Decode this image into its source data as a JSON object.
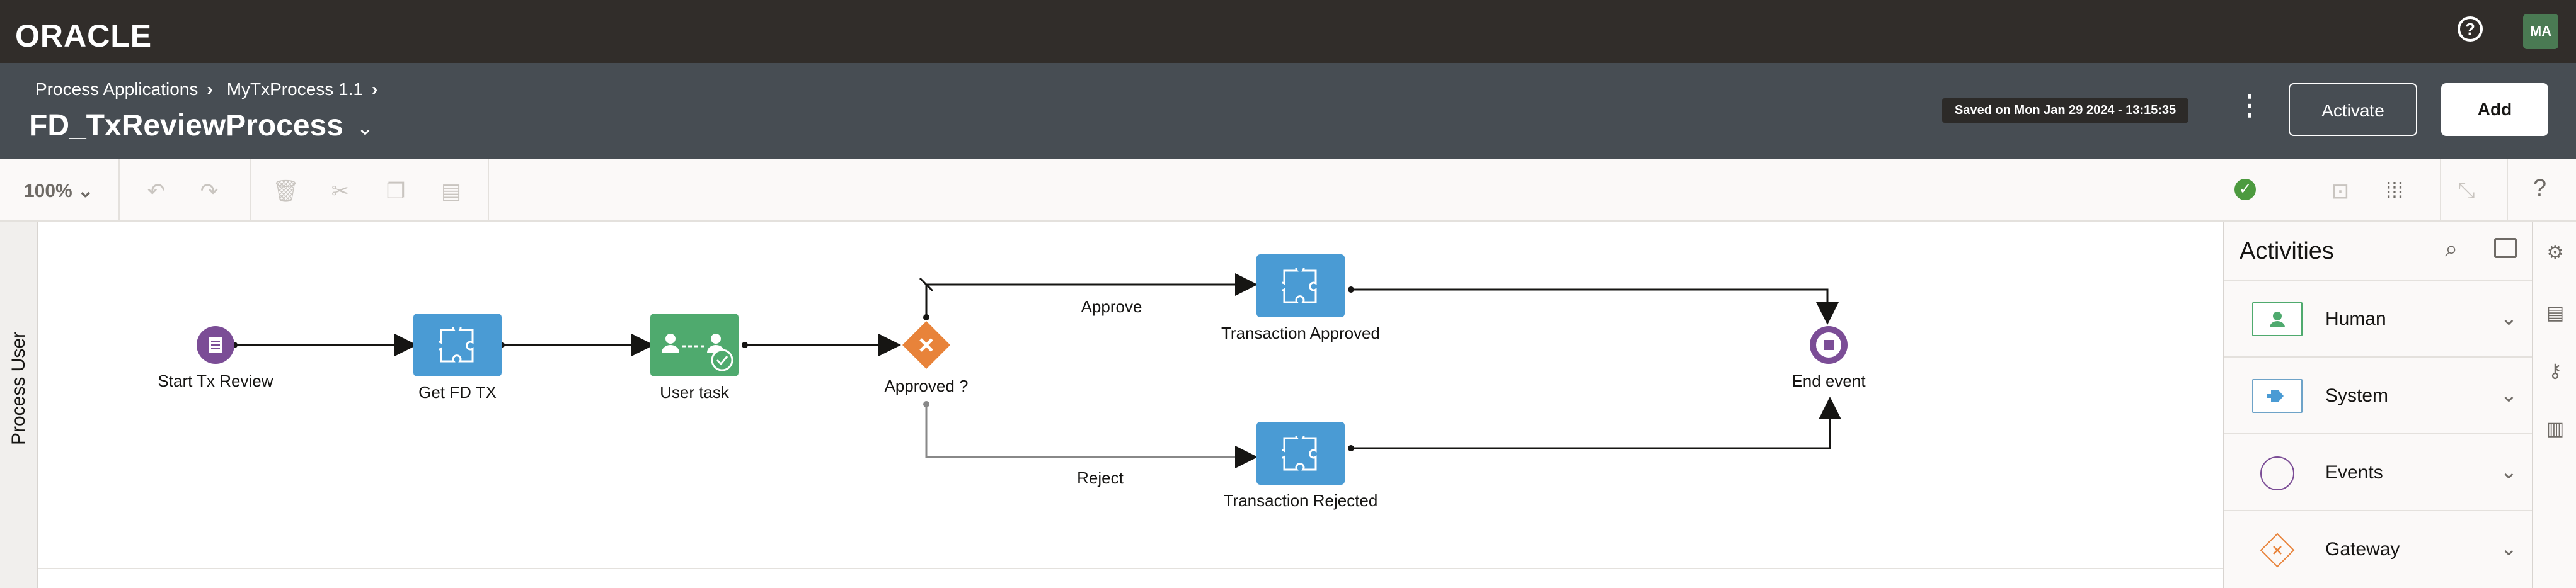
{
  "topbar": {
    "logo": "ORACLE",
    "help_icon": "?",
    "avatar_initials": "MA"
  },
  "header": {
    "breadcrumbs": [
      "Process Applications",
      "MyTxProcess 1.1"
    ],
    "title": "FD_TxReviewProcess",
    "saved_text": "Saved on Mon Jan 29 2024 - 13:15:35",
    "activate_label": "Activate",
    "add_label": "Add"
  },
  "toolbar": {
    "zoom": "100%",
    "icons": [
      "undo-icon",
      "redo-icon",
      "delete-icon",
      "cut-icon",
      "copy-icon",
      "paste-icon",
      "validate-ok-icon",
      "lock-icon",
      "grid-icon",
      "collapse-icon",
      "help-icon"
    ]
  },
  "lane": {
    "label": "Process User"
  },
  "diagram": {
    "nodes": {
      "start": "Start Tx Review",
      "get_fd_tx": "Get FD TX",
      "user_task": "User task",
      "gateway": "Approved ?",
      "tx_approved": "Transaction Approved",
      "tx_rejected": "Transaction Rejected",
      "end": "End event"
    },
    "flows": {
      "approve": "Approve",
      "reject": "Reject"
    },
    "colors": {
      "service_task": "#4a9bd4",
      "user_task": "#4faa6e",
      "event": "#7b4d96",
      "gateway": "#e8833a"
    }
  },
  "activities": {
    "title": "Activities",
    "items": [
      {
        "label": "Human",
        "icon": "human-icon"
      },
      {
        "label": "System",
        "icon": "system-icon"
      },
      {
        "label": "Events",
        "icon": "events-icon"
      },
      {
        "label": "Gateway",
        "icon": "gateway-icon"
      }
    ]
  },
  "rail": {
    "icons": [
      "settings-icon",
      "documents-icon",
      "key-icon",
      "chart-icon"
    ]
  }
}
